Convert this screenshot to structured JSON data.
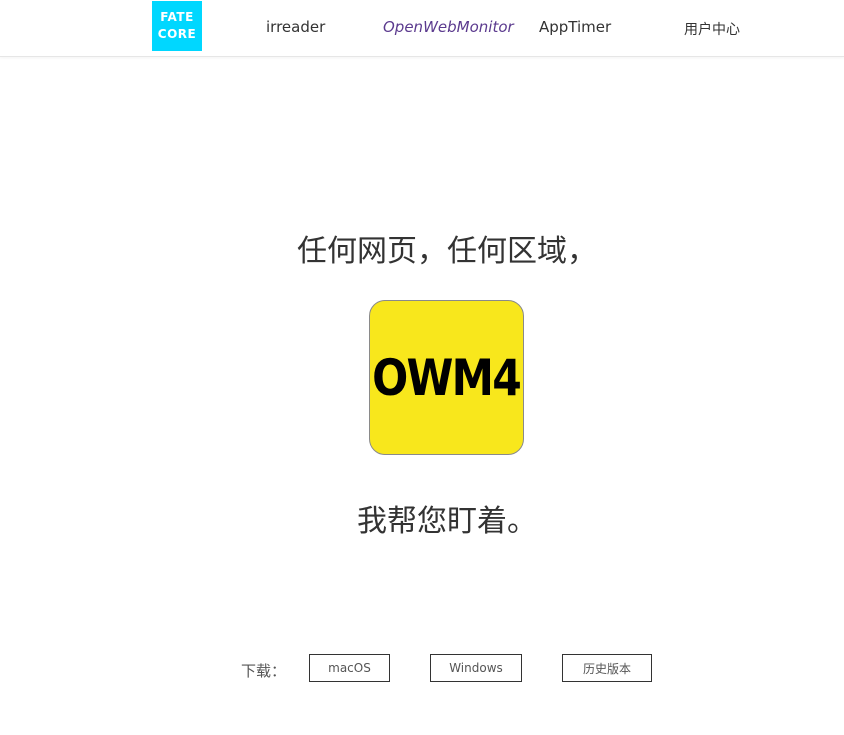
{
  "nav": {
    "logo_line1": "FATE",
    "logo_line2": "CORE",
    "links": [
      {
        "label": "irreader"
      },
      {
        "label": "OpenWebMonitor"
      },
      {
        "label": "AppTimer"
      },
      {
        "label": "用户中心"
      }
    ]
  },
  "hero": {
    "headline": "任何网页，任何区域，",
    "app_icon_text": "OWM4",
    "subline": "我帮您盯着。"
  },
  "download": {
    "label": "下载：",
    "buttons": [
      {
        "label": "macOS"
      },
      {
        "label": "Windows"
      },
      {
        "label": "历史版本"
      }
    ]
  },
  "colors": {
    "logo_bg": "#00d7ff",
    "icon_bg": "#f8e71c",
    "active_link": "#5b3a8e",
    "text": "#333333"
  }
}
